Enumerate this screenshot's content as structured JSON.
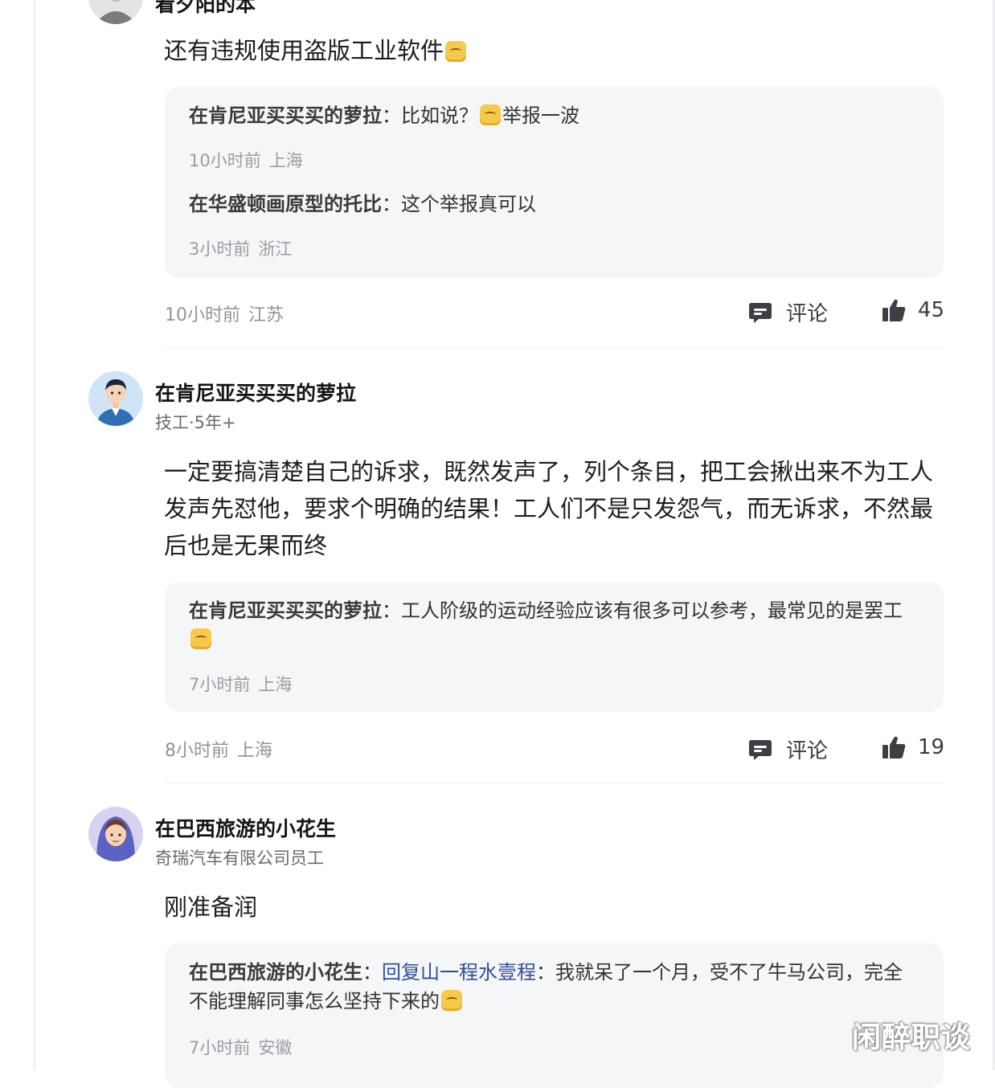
{
  "comments": [
    {
      "username": "看夕阳的本",
      "text": "还有违规使用盗版工业软件",
      "replies": [
        {
          "author": "在肯尼亚买买买的萝拉",
          "sep": "：",
          "text_before": "比如说？",
          "text_after": "举报一波",
          "time": "10小时前",
          "location": "上海"
        },
        {
          "author": "在华盛顿画原型的托比",
          "sep": "：",
          "text": "这个举报真可以",
          "time": "3小时前",
          "location": "浙江"
        }
      ],
      "time": "10小时前",
      "location": "江苏",
      "comment_label": "评论",
      "likes": "45"
    },
    {
      "username": "在肯尼亚买买买的萝拉",
      "subtitle": "技工·5年+",
      "text": "一定要搞清楚自己的诉求，既然发声了，列个条目，把工会揪出来不为工人发声先怼他，要求个明确的结果！工人们不是只发怨气，而无诉求，不然最后也是无果而终",
      "replies": [
        {
          "author": "在肯尼亚买买买的萝拉",
          "sep": "：",
          "text": "工人阶级的运动经验应该有很多可以参考，最常见的是罢工",
          "time": "7小时前",
          "location": "上海"
        }
      ],
      "time": "8小时前",
      "location": "上海",
      "comment_label": "评论",
      "likes": "19"
    },
    {
      "username": "在巴西旅游的小花生",
      "subtitle": "奇瑞汽车有限公司员工",
      "text": "刚准备润",
      "replies": [
        {
          "author": "在巴西旅游的小花生",
          "sep": "：",
          "mention": "回复山一程水壹程",
          "sep2": "：",
          "text": "我就呆了一个月，受不了牛马公司，完全不能理解同事怎么坚持下来的",
          "time": "7小时前",
          "location": "安徽"
        }
      ]
    }
  ],
  "icons": {
    "comment": "comment-bubble-icon",
    "like": "thumbs-up-icon",
    "emoji": "smile-emoji-icon"
  },
  "colors": {
    "mention": "#2f4e9a",
    "reply_bg": "#f5f6f8",
    "meta": "#8f9399"
  },
  "watermark": "闲醉职谈"
}
